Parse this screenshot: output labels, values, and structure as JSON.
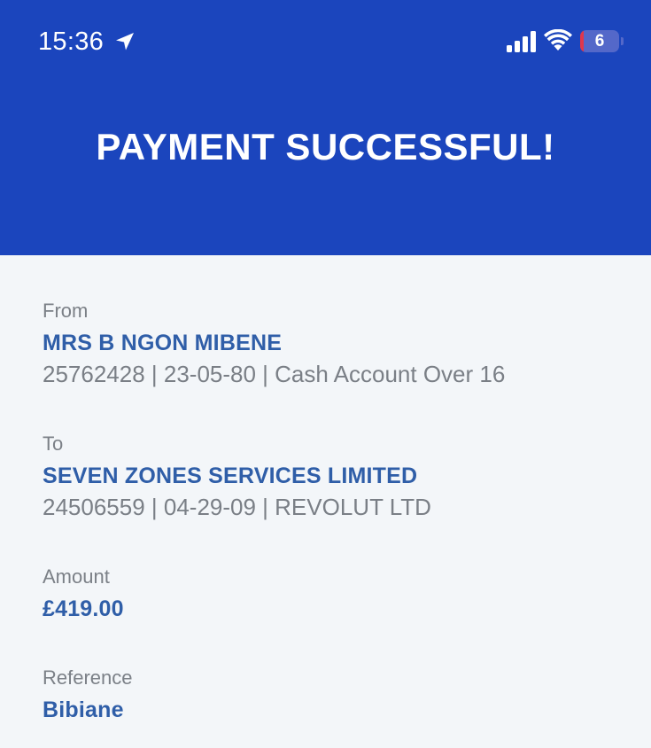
{
  "status_bar": {
    "time": "15:36",
    "battery_level": "6",
    "icons": [
      "location-arrow-icon",
      "cellular-signal-icon",
      "wifi-icon",
      "battery-icon"
    ]
  },
  "header": {
    "title": "PAYMENT SUCCESSFUL!",
    "background_color": "#1b45bd"
  },
  "payment": {
    "from": {
      "label": "From",
      "name": "MRS B NGON MIBENE",
      "details": "25762428 | 23-05-80 | Cash Account Over 16"
    },
    "to": {
      "label": "To",
      "name": "SEVEN ZONES SERVICES LIMITED",
      "details": "24506559 | 04-29-09 | REVOLUT LTD"
    },
    "amount": {
      "label": "Amount",
      "value": "£419.00"
    },
    "reference": {
      "label": "Reference",
      "value": "Bibiane"
    }
  },
  "colors": {
    "accent_text": "#2f5ea8",
    "muted_text": "#7a7f86",
    "page_background": "#f3f6f9"
  }
}
